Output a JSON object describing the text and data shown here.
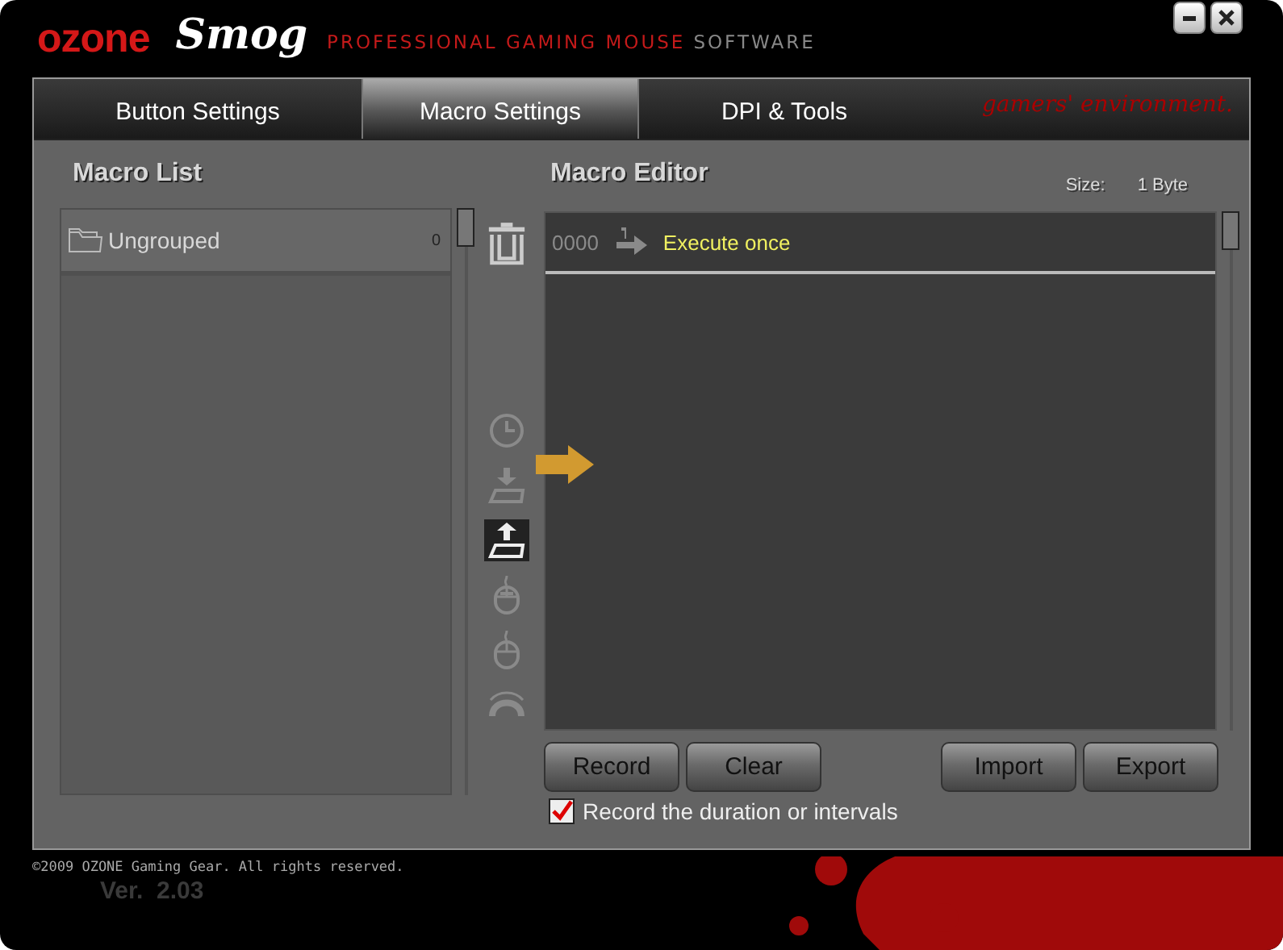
{
  "window": {
    "brand": "ozone",
    "product": "Smog",
    "tagline": "PROFESSIONAL GAMING MOUSE",
    "tagline_suffix": "SOFTWARE",
    "slogan": "gamers' environment."
  },
  "tabs": [
    {
      "label": "Button Settings",
      "selected": false
    },
    {
      "label": "Macro Settings",
      "selected": true
    },
    {
      "label": "DPI & Tools",
      "selected": false
    }
  ],
  "macro_list": {
    "title": "Macro List",
    "groups": [
      {
        "name": "Ungrouped",
        "count": "0"
      }
    ]
  },
  "tools": [
    {
      "kind": "delete",
      "selected": false
    },
    {
      "kind": "delay",
      "selected": false
    },
    {
      "kind": "key_down",
      "selected": false
    },
    {
      "kind": "key_up",
      "selected": true
    },
    {
      "kind": "mouse_down",
      "selected": false
    },
    {
      "kind": "mouse_up",
      "selected": false
    },
    {
      "kind": "wheel",
      "selected": false
    }
  ],
  "editor": {
    "title": "Macro Editor",
    "size_label": "Size:",
    "size_value": "1 Byte",
    "rows": [
      {
        "index": "0000",
        "text": "Execute once"
      }
    ]
  },
  "buttons": [
    "Record",
    "Clear",
    "Import",
    "Export"
  ],
  "checkbox": {
    "label": "Record the duration or intervals",
    "checked": true
  },
  "footer": {
    "copyright": "©2009 OZONE Gaming Gear. All rights reserved.",
    "version": "Ver.  2.03"
  }
}
